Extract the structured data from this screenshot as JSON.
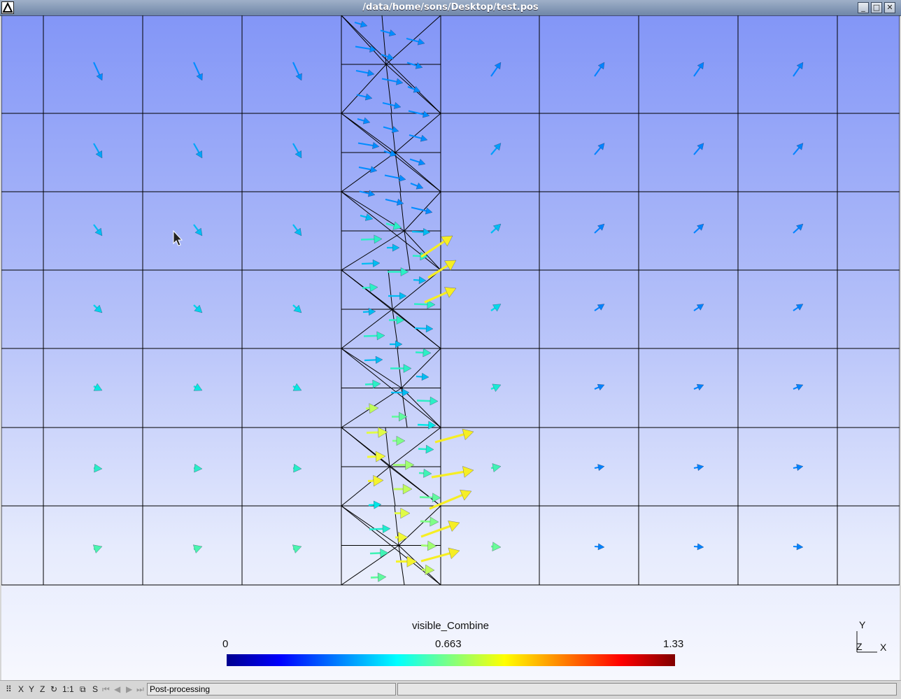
{
  "window": {
    "title": "/data/home/sons/Desktop/test.pos",
    "buttons": [
      "minimize",
      "maximize",
      "close"
    ]
  },
  "view": {
    "scale": {
      "name": "visible_Combine",
      "min": "0",
      "mid": "0.663",
      "max": "1.33"
    },
    "axes": {
      "y": "Y",
      "z": "Z",
      "x": "X"
    }
  },
  "statusbar": {
    "buttons": [
      "X",
      "Y",
      "Z",
      "↻",
      "1:1",
      "S"
    ],
    "icons": [
      "grid-icon",
      "rotate-icon",
      "snapshot-icon",
      "first-icon",
      "prev-icon",
      "play-icon",
      "last-icon"
    ],
    "message": "Post-processing"
  },
  "colors": {
    "bg_top": "#8396f7",
    "bg_bottom": "#f7f8fe",
    "mesh": "#000000"
  }
}
